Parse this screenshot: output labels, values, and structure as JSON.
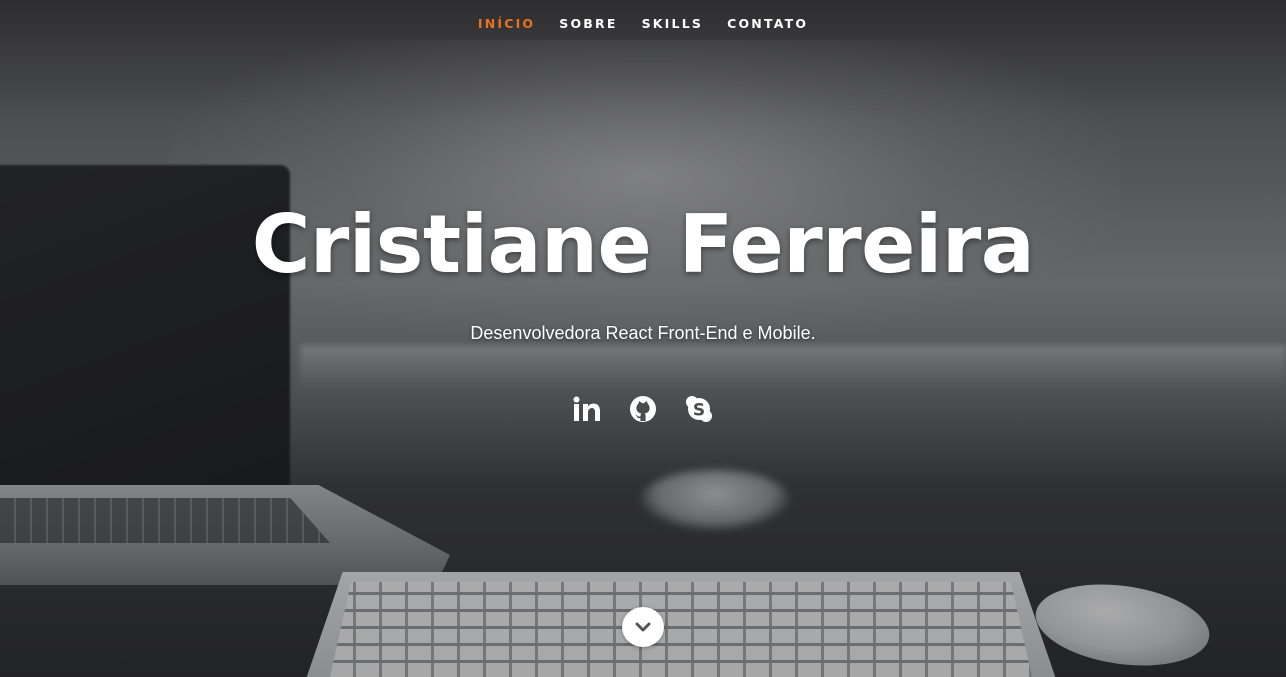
{
  "nav": {
    "items": [
      {
        "label": "INÍCIO",
        "active": true
      },
      {
        "label": "SOBRE",
        "active": false
      },
      {
        "label": "SKILLS",
        "active": false
      },
      {
        "label": "CONTATO",
        "active": false
      }
    ],
    "active_color": "#e8731f"
  },
  "hero": {
    "title": "Cristiane Ferreira",
    "subtitle": "Desenvolvedora React Front-End e Mobile."
  },
  "socials": [
    {
      "icon": "linkedin-icon"
    },
    {
      "icon": "github-icon"
    },
    {
      "icon": "skype-icon"
    }
  ],
  "scroll": {
    "icon": "chevron-down-icon"
  }
}
